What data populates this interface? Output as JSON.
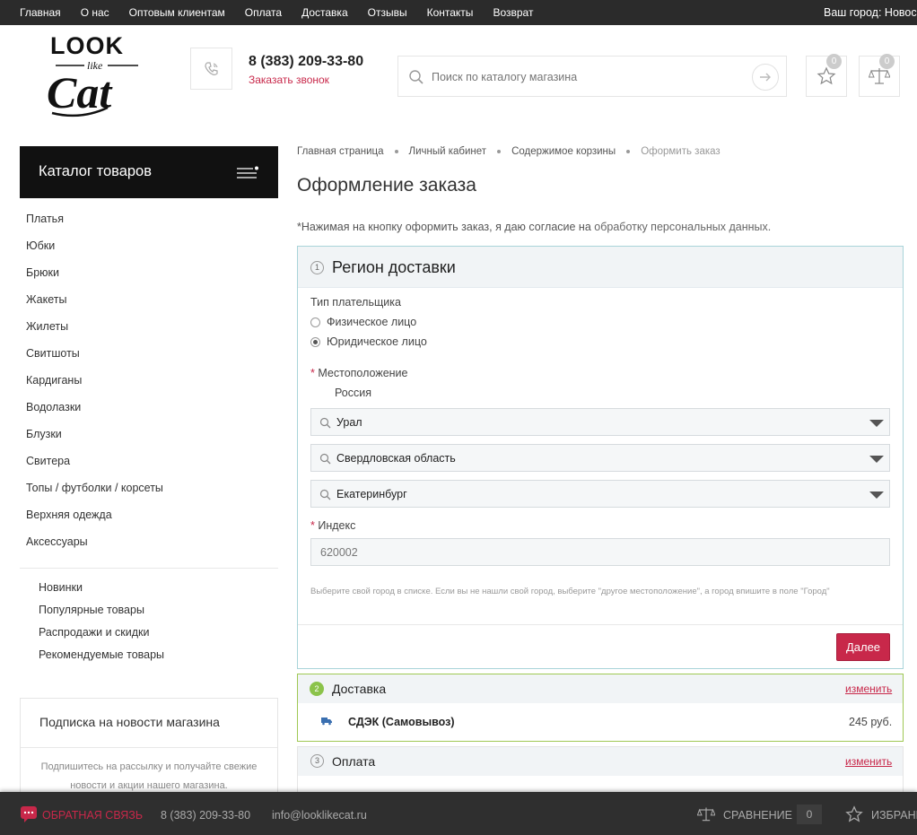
{
  "topbar": {
    "nav": [
      "Главная",
      "О нас",
      "Оптовым клиентам",
      "Оплата",
      "Доставка",
      "Отзывы",
      "Контакты",
      "Возврат"
    ],
    "city_label": "Ваш город:",
    "city_value": "Новосибирск"
  },
  "header": {
    "logo_text": "LOOK like Cat",
    "phone": "8 (383) 209-33-80",
    "callback": "Заказать звонок",
    "search_placeholder": "Поиск по каталогу магазина",
    "favorites_count": "0",
    "compare_count": "0"
  },
  "sidebar": {
    "catalog_title": "Каталог товаров",
    "categories": [
      "Платья",
      "Юбки",
      "Брюки",
      "Жакеты",
      "Жилеты",
      "Свитшоты",
      "Кардиганы",
      "Водолазки",
      "Блузки",
      "Свитера",
      "Топы / футболки / корсеты",
      "Верхняя одежда",
      "Аксессуары"
    ],
    "extras": [
      "Новинки",
      "Популярные товары",
      "Распродажи и скидки",
      "Рекомендуемые товары"
    ],
    "subscribe_title": "Подписка на новости магазина",
    "subscribe_text": "Подпишитесь на рассылку и получайте свежие новости и акции нашего магазина."
  },
  "breadcrumbs": [
    "Главная страница",
    "Личный кабинет",
    "Содержимое корзины",
    "Оформить заказ"
  ],
  "page_title": "Оформление заказа",
  "notice": {
    "text": "*Нажимая на кнопку оформить заказ, я даю согласие на ",
    "link": "обработку персональных данных."
  },
  "region": {
    "step": "1",
    "title": "Регион доставки",
    "payer_label": "Тип плательщика",
    "payer_options": [
      "Физическое лицо",
      "Юридическое лицо"
    ],
    "payer_selected": "Юридическое лицо",
    "location_label": "Местоположение",
    "country": "Россия",
    "selects": [
      "Урал",
      "Свердловская область",
      "Екатеринбург"
    ],
    "index_label": "Индекс",
    "index_value": "620002",
    "hint": "Выберите свой город в списке. Если вы не нашли свой город, выберите \"другое местоположение\", а город впишите в поле \"Город\"",
    "next_button": "Далее"
  },
  "delivery": {
    "step": "2",
    "title": "Доставка",
    "change": "изменить",
    "service": "СДЭК (Самовывоз)",
    "price": "245 руб."
  },
  "payment": {
    "step": "3",
    "title": "Оплата",
    "change": "изменить"
  },
  "footer": {
    "feedback": "ОБРАТНАЯ СВЯЗЬ",
    "phone": "8 (383) 209-33-80",
    "email": "info@looklikecat.ru",
    "compare": "СРАВНЕНИЕ",
    "compare_count": "0",
    "favorites": "ИЗБРАННОЕ"
  },
  "colors": {
    "accent": "#c8284a",
    "topbar": "#2b2b2b",
    "catalog_header": "#111111",
    "region_border": "#a9d4d9",
    "delivery_border": "#9fc853"
  }
}
